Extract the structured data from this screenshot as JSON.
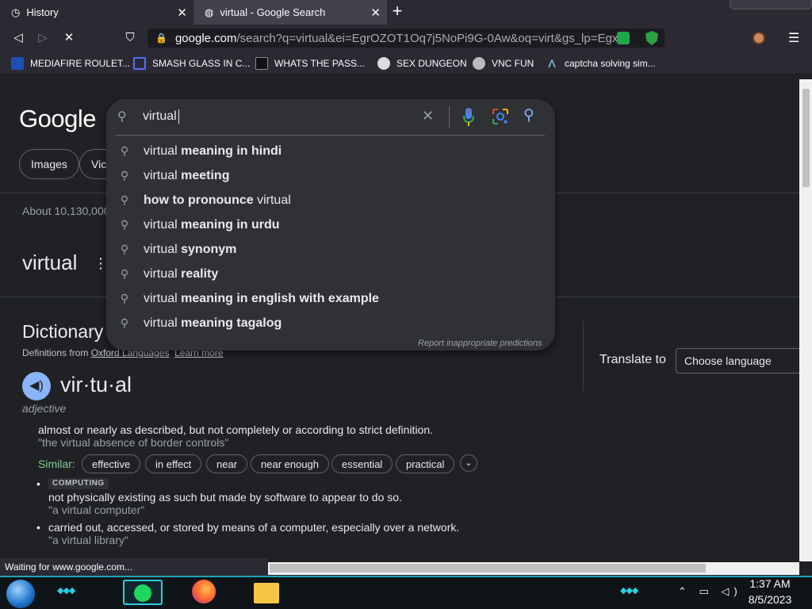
{
  "browser": {
    "tabs": [
      {
        "title": "History",
        "icon": "history-icon",
        "close": "✕"
      },
      {
        "title": "virtual - Google Search",
        "icon": "globe-icon",
        "close": "✕"
      }
    ],
    "new_tab": "+",
    "url": {
      "host": "google.com",
      "rest": "/search?q=virtual&ei=EgrOZOT1Oq7j5NoPi9G-0Aw&oq=virt&gs_lp=Egx..."
    },
    "bookmarks": [
      {
        "label": "MEDIAFIRE ROULET...",
        "icon": "mediafire-icon"
      },
      {
        "label": "SMASH GLASS IN C...",
        "icon": "bracket-icon"
      },
      {
        "label": "WHATS THE PASS...",
        "icon": "camera-icon"
      },
      {
        "label": "SEX DUNGEON",
        "icon": "badge-icon"
      },
      {
        "label": "VNC FUN",
        "icon": "gear-icon"
      },
      {
        "label": "captcha solving sim...",
        "icon": "triangle-icon"
      }
    ],
    "status": "Waiting for www.google.com..."
  },
  "search": {
    "logo": "Google",
    "query": "virtual",
    "suggestions": [
      {
        "plain": "virtual ",
        "bold": "meaning in hindi",
        "bold_first": false
      },
      {
        "plain": "virtual ",
        "bold": "meeting",
        "bold_first": false
      },
      {
        "plain": "virtual",
        "bold": "how to pronounce ",
        "bold_first": true
      },
      {
        "plain": "virtual ",
        "bold": "meaning in urdu",
        "bold_first": false
      },
      {
        "plain": "virtual ",
        "bold": "synonym",
        "bold_first": false
      },
      {
        "plain": "virtual ",
        "bold": "reality",
        "bold_first": false
      },
      {
        "plain": "virtual ",
        "bold": "meaning in english with example",
        "bold_first": false
      },
      {
        "plain": "virtual ",
        "bold": "meaning tagalog",
        "bold_first": false
      }
    ],
    "report": "Report inappropriate predictions"
  },
  "filters": [
    "Images",
    "Vic"
  ],
  "results": {
    "stats": "About 10,130,000",
    "heading": "virtual",
    "dictionary_title": "Dictionary",
    "source_prefix": "Definitions from ",
    "source_link": "Oxford Languages",
    "learn_more": "Learn more",
    "word": "vir·tu·al",
    "part_of_speech": "adjective",
    "definitions": [
      {
        "text": "almost or nearly as described, but not completely or according to strict definition.",
        "example": "\"the virtual absence of border controls\""
      },
      {
        "tag": "COMPUTING",
        "text": "not physically existing as such but made by software to appear to do so.",
        "example": "\"a virtual computer\""
      },
      {
        "text": "carried out, accessed, or stored by means of a computer, especially over a network.",
        "example": "\"a virtual library\""
      }
    ],
    "similar_label": "Similar:",
    "similar": [
      "effective",
      "in effect",
      "near",
      "near enough",
      "essential",
      "practical"
    ],
    "translate_label": "Translate to",
    "translate_select": "Choose language"
  },
  "taskbar": {
    "time": "1:37 AM",
    "date": "8/5/2023"
  }
}
